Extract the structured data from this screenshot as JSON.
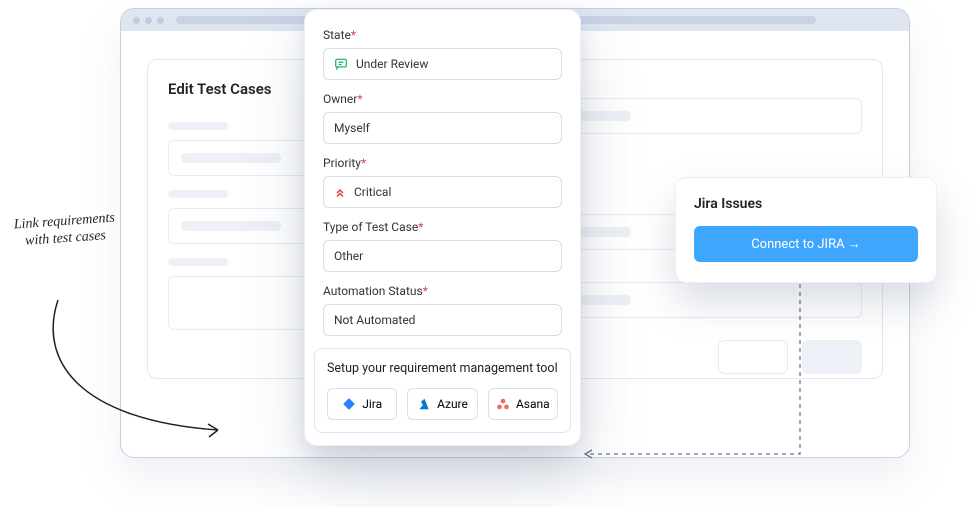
{
  "left_card": {
    "title": "Edit Test Cases"
  },
  "form": {
    "state": {
      "label": "State",
      "value": "Under Review"
    },
    "owner": {
      "label": "Owner",
      "value": "Myself"
    },
    "priority": {
      "label": "Priority",
      "value": "Critical"
    },
    "type": {
      "label": "Type of Test Case",
      "value": "Other"
    },
    "automation": {
      "label": "Automation Status",
      "value": "Not Automated"
    },
    "setup": {
      "label": "Setup your requirement management tool",
      "tools": {
        "jira": "Jira",
        "azure": "Azure",
        "asana": "Asana"
      }
    }
  },
  "jira_pop": {
    "title": "Jira Issues",
    "cta": "Connect to JIRA →"
  },
  "annotation": "Link requirements with test cases"
}
